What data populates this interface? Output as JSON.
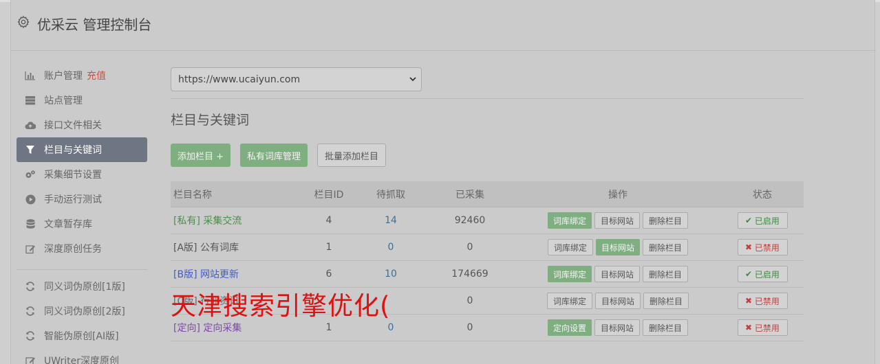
{
  "header": {
    "title": "优采云 管理控制台"
  },
  "sidebar": {
    "items": [
      {
        "label": "账户管理",
        "extra": "充值",
        "icon": "bar-chart-icon"
      },
      {
        "label": "站点管理",
        "icon": "server-icon"
      },
      {
        "label": "接口文件相关",
        "icon": "cloud-upload-icon"
      },
      {
        "label": "栏目与关键词",
        "icon": "filter-icon",
        "active": true
      },
      {
        "label": "采集细节设置",
        "icon": "cogs-icon"
      },
      {
        "label": "手动运行测试",
        "icon": "play-circle-icon"
      },
      {
        "label": "文章暂存库",
        "icon": "database-icon"
      },
      {
        "label": "深度原创任务",
        "icon": "edit-icon"
      }
    ],
    "items2": [
      {
        "label": "同义词伪原创[1版]",
        "icon": "refresh-icon"
      },
      {
        "label": "同义词伪原创[2版]",
        "icon": "refresh-icon"
      },
      {
        "label": "智能伪原创[AI版]",
        "icon": "refresh-icon"
      },
      {
        "label": "UWriter深度原创",
        "icon": "edit-icon"
      }
    ]
  },
  "main": {
    "site_select": "https://www.ucaiyun.com",
    "section_title": "栏目与关键词",
    "buttons": {
      "add": "添加栏目 +",
      "private_lib": "私有词库管理",
      "batch_add": "批量添加栏目"
    },
    "table": {
      "headers": [
        "栏目名称",
        "栏目ID",
        "待抓取",
        "已采集",
        "操作",
        "状态"
      ],
      "rows": [
        {
          "tag": "[私有]",
          "name": "采集交流",
          "id": "4",
          "pending": "14",
          "collected": "92460",
          "op1": "词库绑定",
          "op2": "目标网站",
          "op3": "删除栏目",
          "status": "已启用"
        },
        {
          "tag": "[A版]",
          "name": "公有词库",
          "id": "1",
          "pending": "0",
          "collected": "0",
          "op1": "词库绑定",
          "op2": "目标网站",
          "op3": "删除栏目",
          "status": "已禁用"
        },
        {
          "tag": "[B版]",
          "name": "网站更新",
          "id": "6",
          "pending": "10",
          "collected": "174669",
          "op1": "词库绑定",
          "op2": "目标网站",
          "op3": "删除栏目",
          "status": "已启用"
        },
        {
          "tag": "[C版]",
          "name": "行业资讯",
          "id": "",
          "pending": "",
          "collected": "0",
          "op1": "词库绑定",
          "op2": "目标网站",
          "op3": "删除栏目",
          "status": "已禁用"
        },
        {
          "tag": "[定向]",
          "name": "定向采集",
          "id": "1",
          "pending": "0",
          "collected": "0",
          "op1": "定向设置",
          "op2": "目标网站",
          "op3": "删除栏目",
          "status": "已禁用"
        }
      ]
    }
  },
  "watermark": "天津搜索引擎优化(",
  "colors": {
    "green": "#7fae80",
    "active_nav": "#6e7684",
    "enabled": "#3d8a3d",
    "disabled": "#c43d3d",
    "watermark": "#e01010"
  }
}
